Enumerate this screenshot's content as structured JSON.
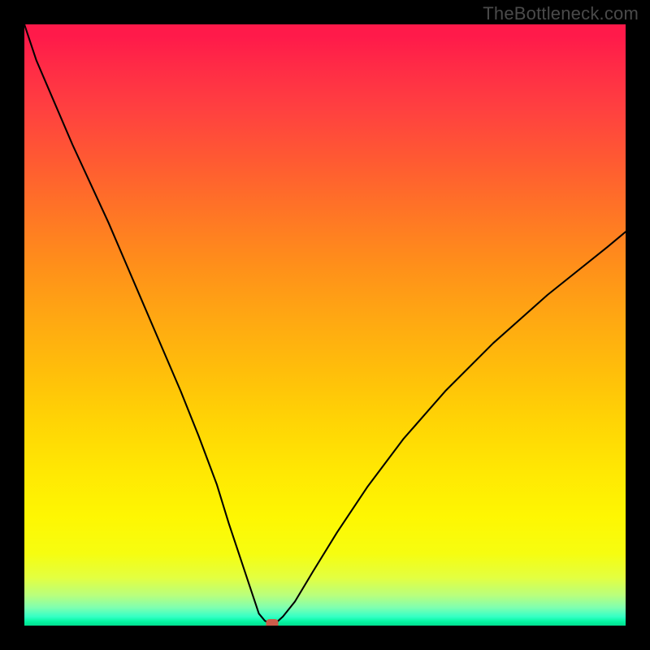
{
  "watermark": "TheBottleneck.com",
  "chart_data": {
    "type": "line",
    "title": "",
    "xlabel": "",
    "ylabel": "",
    "xlim": [
      0,
      100
    ],
    "ylim": [
      0,
      100
    ],
    "x": [
      0,
      2,
      5,
      8,
      11,
      14,
      17,
      20,
      23,
      26,
      29,
      32,
      34,
      36,
      37.5,
      38.5,
      39,
      40,
      41,
      41.5,
      42,
      43,
      45,
      48,
      52,
      57,
      63,
      70,
      78,
      87,
      97,
      100
    ],
    "y": [
      100,
      94,
      87,
      80,
      73.5,
      67,
      60,
      53,
      46,
      39,
      31.5,
      23.5,
      17,
      11,
      6.5,
      3.5,
      2,
      0.8,
      0.3,
      0.3,
      0.6,
      1.5,
      4,
      9,
      15.5,
      23,
      31,
      39,
      47,
      55,
      63,
      65.5
    ],
    "marker": {
      "x": 41.2,
      "y": 0.3
    },
    "background_gradient": {
      "top_color": "#ff1a4a",
      "mid_color": "#ffd405",
      "bottom_color": "#02dd8f"
    }
  }
}
